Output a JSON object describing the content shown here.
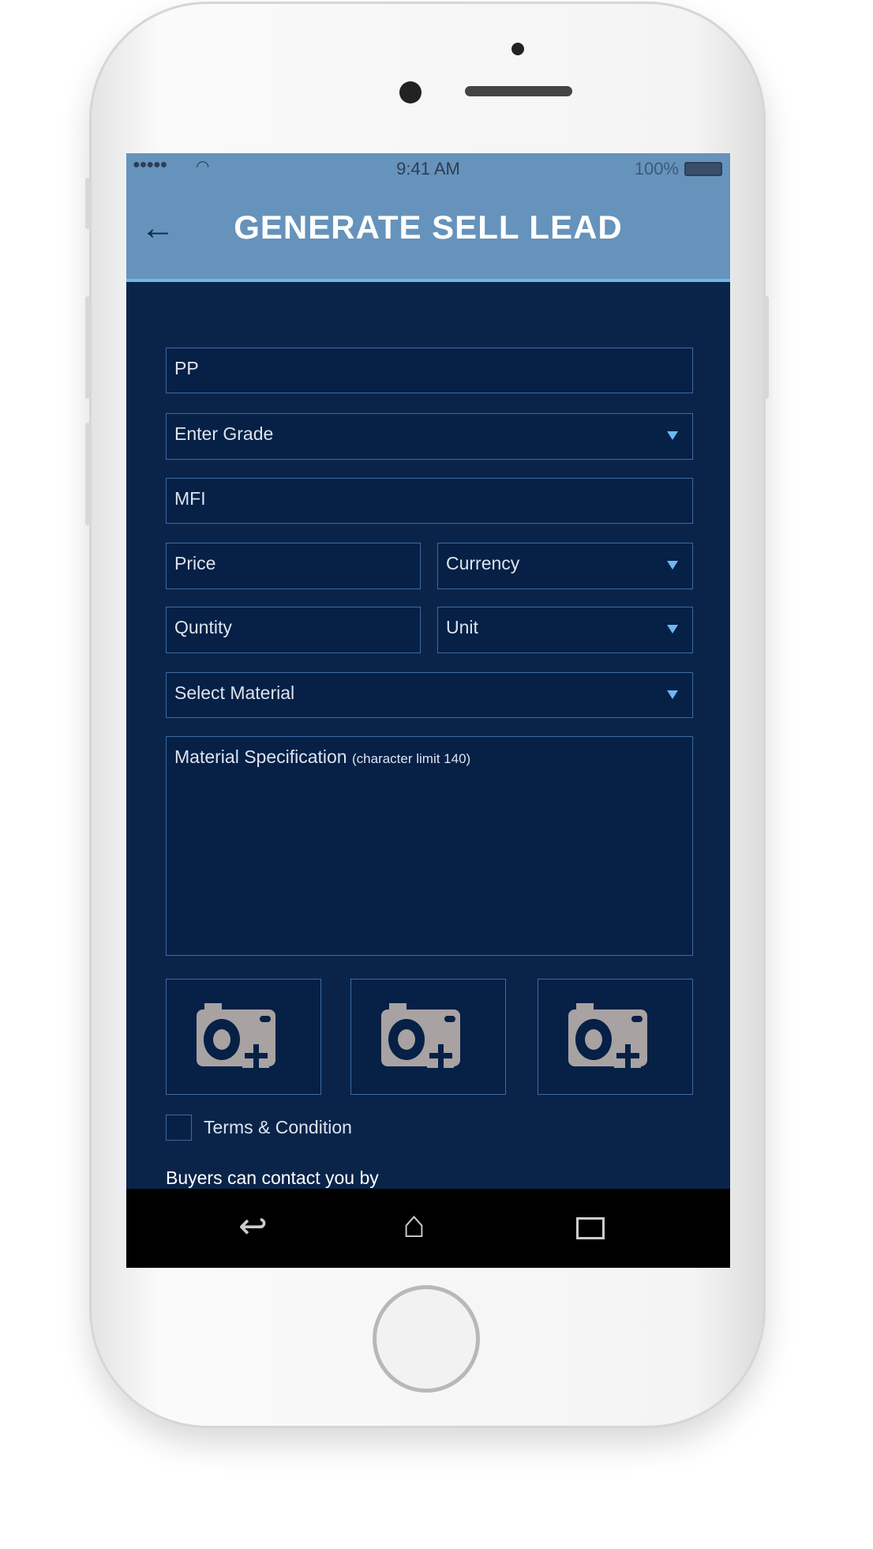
{
  "status_bar": {
    "time": "9:41 AM",
    "battery": "100%"
  },
  "header": {
    "title": "GENERATE SELL LEAD"
  },
  "form": {
    "product": "PP",
    "grade_placeholder": "Enter Grade",
    "mfi": "MFI",
    "price_placeholder": "Price",
    "currency_placeholder": "Currency",
    "quantity_placeholder": "Quntity",
    "unit_placeholder": "Unit",
    "material_placeholder": "Select Material",
    "spec_placeholder": "Material Specification",
    "spec_hint": "(character limit 140)",
    "terms_label": "Terms & Condition",
    "terms_checked": false,
    "contact_label": "Buyers can contact you by"
  },
  "colors": {
    "header": "#6693bb",
    "background": "#0a2449",
    "accent": "#6cb8ee"
  }
}
